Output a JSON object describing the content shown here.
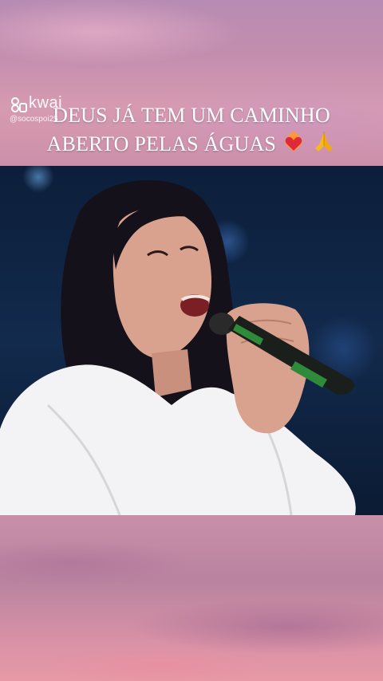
{
  "app": {
    "name": "kwai",
    "handle": "@socospoi25"
  },
  "caption": {
    "line1": "DEUS JÁ TEM UM CAMINHO",
    "line2": "ABERTO PELAS ÁGUAS"
  },
  "icons": [
    "kwai-logo-icon",
    "heart-on-fire-emoji-icon",
    "praying-hands-emoji-icon"
  ],
  "colors": {
    "caption_text": "#ffffff",
    "sky": "#c98aa4",
    "stage": "#0c1e3a"
  }
}
